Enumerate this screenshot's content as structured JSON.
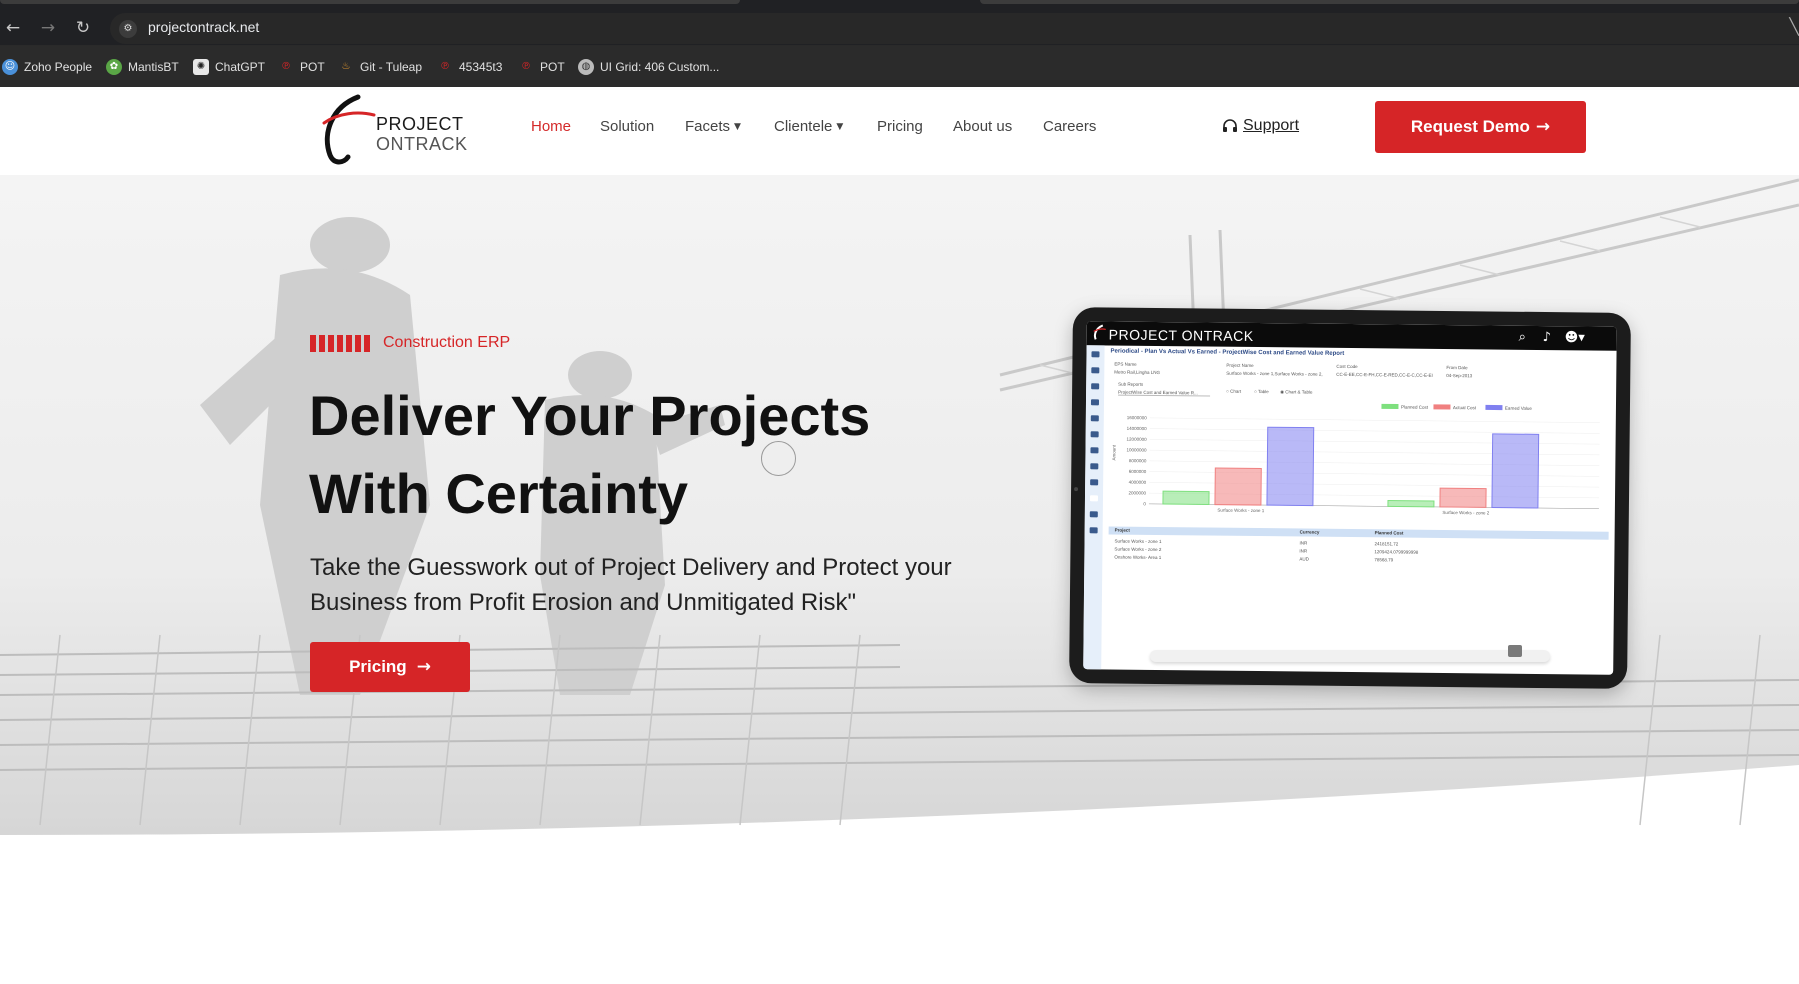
{
  "browser": {
    "url": "projectontrack.net",
    "bookmarks": [
      {
        "label": "Zoho People",
        "icon": "zoho-icon"
      },
      {
        "label": "MantisBT",
        "icon": "mantis-icon"
      },
      {
        "label": "ChatGPT",
        "icon": "chatgpt-icon"
      },
      {
        "label": "POT",
        "icon": "pot-icon"
      },
      {
        "label": "Git - Tuleap",
        "icon": "tuleap-icon"
      },
      {
        "label": "45345t3",
        "icon": "pot-icon"
      },
      {
        "label": "POT",
        "icon": "pot-icon"
      },
      {
        "label": "UI Grid: 406 Custom...",
        "icon": "globe-icon"
      }
    ]
  },
  "header": {
    "logo_line1": "PROJECT",
    "logo_line2": "ONTRACK",
    "nav": [
      {
        "label": "Home",
        "active": true
      },
      {
        "label": "Solution"
      },
      {
        "label": "Facets",
        "dropdown": true
      },
      {
        "label": "Clientele",
        "dropdown": true
      },
      {
        "label": "Pricing"
      },
      {
        "label": "About us"
      },
      {
        "label": "Careers"
      }
    ],
    "support_label": "Support",
    "demo_label": "Request Demo",
    "accent": "#d62527"
  },
  "hero": {
    "eyebrow": "Construction ERP",
    "title_line1": "Deliver Your Projects",
    "title_line2": "With Certainty",
    "subtitle_line1": "Take the Guesswork out of Project Delivery and Protect your",
    "subtitle_line2": "Business from Profit Erosion and Unmitigated Risk\"",
    "cta_label": "Pricing"
  },
  "tablet": {
    "app_brand": "PROJECT ONTRACK",
    "report_title": "Periodical - Plan Vs Actual Vs Earned - ProjectWise Cost and Earned Value Report",
    "filters": [
      {
        "label": "EPS Name",
        "value": "Metro Rail,Lingha LNG"
      },
      {
        "label": "Project Name",
        "value": "Surface Works - zone 1,Surface Works - zone 2,"
      },
      {
        "label": "Cost Code",
        "value": "CC-E-EE,CC-E-FH,CC-E-RED,CC-E-C,CC-E-EI"
      },
      {
        "label": "From Date",
        "value": "04-Sep-2013"
      }
    ],
    "sub_report_label": "Sub Reports",
    "sub_report_value": "ProjectWise Cost and Earned Value R...",
    "view_options": [
      "Chart",
      "Table",
      "Chart & Table"
    ],
    "chart_data": {
      "type": "bar",
      "ylabel": "Amount",
      "categories": [
        "Surface Works - zone 1",
        "Surface Works - zone 2"
      ],
      "yticks": [
        "0",
        "2000000",
        "4000000",
        "6000000",
        "8000000",
        "10000000",
        "12000000",
        "14000000",
        "16000000"
      ],
      "ylim": [
        0,
        16000000
      ],
      "series": [
        {
          "name": "Planned Cost",
          "color": "#7ee07e",
          "values": [
            2400000,
            1100000
          ]
        },
        {
          "name": "Actual Cost",
          "color": "#f08080",
          "values": [
            6800000,
            3500000
          ]
        },
        {
          "name": "Earned Value",
          "color": "#8080f0",
          "values": [
            14500000,
            13700000
          ]
        }
      ]
    },
    "table": {
      "columns": [
        "Project",
        "Currency",
        "Planned Cost"
      ],
      "rows": [
        [
          "Surface Works - zone 1",
          "INR",
          "2418151.72"
        ],
        [
          "Surface Works - zone 2",
          "INR",
          "1209424.0799999998"
        ],
        [
          "Onshore Works- Area 1",
          "AUD",
          "78568.79"
        ]
      ]
    }
  }
}
